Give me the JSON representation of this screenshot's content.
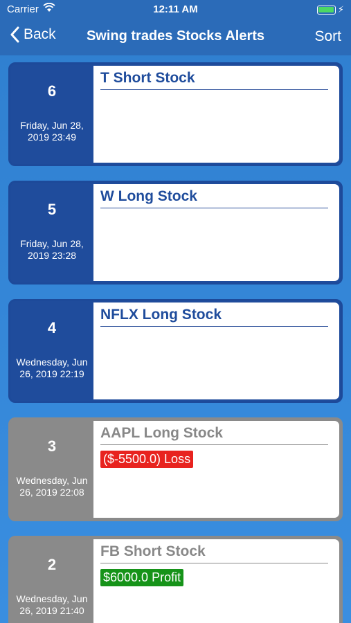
{
  "status_bar": {
    "carrier": "Carrier",
    "time": "12:11 AM"
  },
  "nav": {
    "back_label": "Back",
    "title": "Swing trades Stocks Alerts",
    "sort_label": "Sort"
  },
  "alerts": [
    {
      "number": "6",
      "date": "Friday, Jun 28, 2019 23:49",
      "title": "T Short Stock",
      "status": "active",
      "result": ""
    },
    {
      "number": "5",
      "date": "Friday, Jun 28, 2019 23:28",
      "title": "W Long Stock",
      "status": "active",
      "result": ""
    },
    {
      "number": "4",
      "date": "Wednesday, Jun 26, 2019 22:19",
      "title": "NFLX Long Stock",
      "status": "active",
      "result": ""
    },
    {
      "number": "3",
      "date": "Wednesday, Jun 26, 2019 22:08",
      "title": "AAPL Long Stock",
      "status": "closed",
      "result": "($-5500.0) Loss",
      "result_type": "loss"
    },
    {
      "number": "2",
      "date": "Wednesday, Jun 26, 2019 21:40",
      "title": "FB Short Stock",
      "status": "closed",
      "result": "$6000.0 Profit",
      "result_type": "profit"
    }
  ],
  "colors": {
    "nav": "#2b6bb8",
    "active_card": "#1f4c9c",
    "closed_card": "#8a8a8a",
    "loss": "#e8231f",
    "profit": "#169319"
  }
}
